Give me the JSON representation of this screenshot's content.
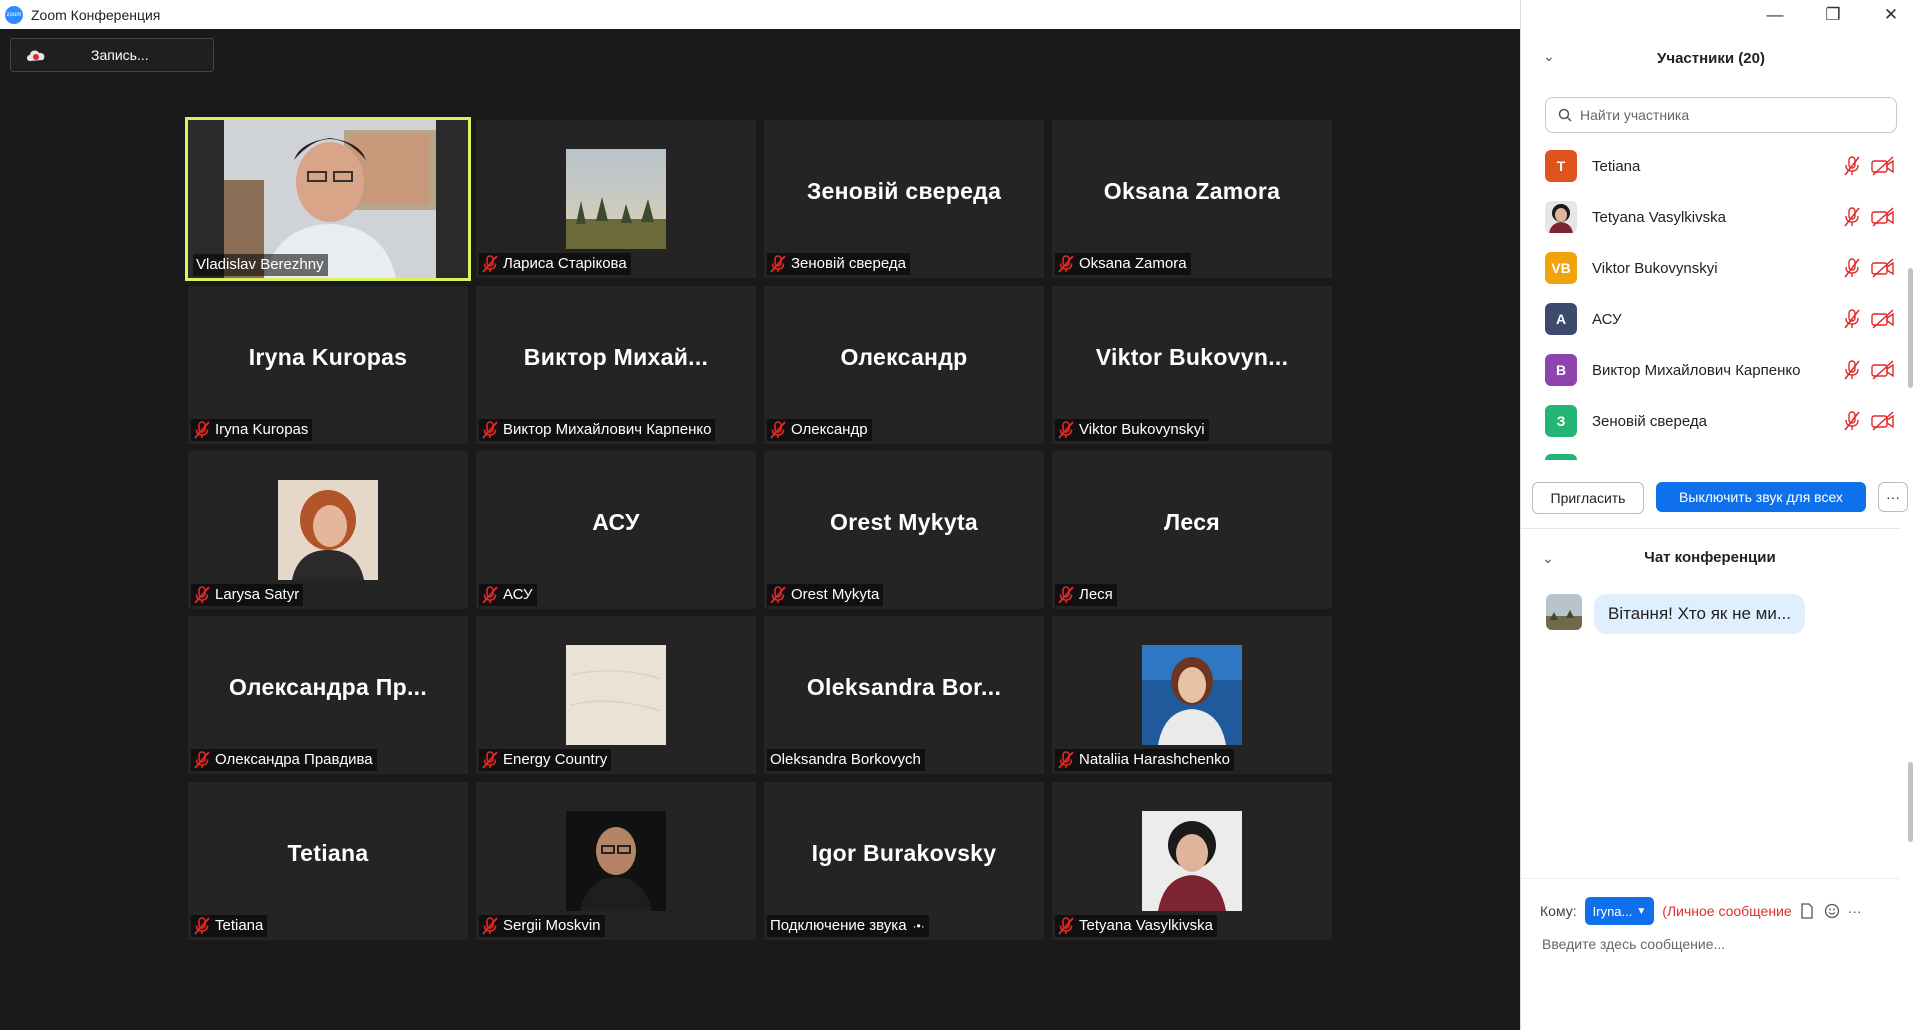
{
  "window": {
    "title": "Zoom Конференция",
    "controls": [
      "—",
      "❐",
      "✕"
    ]
  },
  "record": {
    "label": "Запись..."
  },
  "tiles": [
    {
      "id": "t1",
      "bigname": "",
      "nametag": "Vladislav Berezhny",
      "muted": false,
      "kind": "video"
    },
    {
      "id": "t2",
      "bigname": "",
      "nametag": "Лариса Старікова",
      "muted": true,
      "kind": "pic",
      "pic": "landscape"
    },
    {
      "id": "t3",
      "bigname": "Зеновій свереда",
      "nametag": "Зеновій свереда",
      "muted": true,
      "kind": "name"
    },
    {
      "id": "t4",
      "bigname": "Oksana Zamora",
      "nametag": "Oksana Zamora",
      "muted": true,
      "kind": "name"
    },
    {
      "id": "t5",
      "bigname": "Iryna Kuropas",
      "nametag": "Iryna Kuropas",
      "muted": true,
      "kind": "name"
    },
    {
      "id": "t6",
      "bigname": "Виктор Михай...",
      "nametag": "Виктор Михайлович Карпенко",
      "muted": true,
      "kind": "name"
    },
    {
      "id": "t7",
      "bigname": "Олександр",
      "nametag": "Олександр",
      "muted": true,
      "kind": "name"
    },
    {
      "id": "t8",
      "bigname": "Viktor Bukovyn...",
      "nametag": "Viktor Bukovynskyi",
      "muted": true,
      "kind": "name"
    },
    {
      "id": "t9",
      "bigname": "",
      "nametag": "Larysa Satyr",
      "muted": true,
      "kind": "pic",
      "pic": "woman-red"
    },
    {
      "id": "t10",
      "bigname": "АСУ",
      "nametag": "АСУ",
      "muted": true,
      "kind": "name"
    },
    {
      "id": "t11",
      "bigname": "Orest Mykyta",
      "nametag": "Orest Mykyta",
      "muted": true,
      "kind": "name"
    },
    {
      "id": "t12",
      "bigname": "Леся",
      "nametag": "Леся",
      "muted": true,
      "kind": "name"
    },
    {
      "id": "t13",
      "bigname": "Олександра Пр...",
      "nametag": "Олександра Правдива",
      "muted": true,
      "kind": "name"
    },
    {
      "id": "t14",
      "bigname": "",
      "nametag": "Energy Country",
      "muted": true,
      "kind": "pic",
      "pic": "paper"
    },
    {
      "id": "t15",
      "bigname": "Oleksandra Bor...",
      "nametag": "Oleksandra Borkovych",
      "muted": false,
      "kind": "name"
    },
    {
      "id": "t16",
      "bigname": "",
      "nametag": "Nataliia Harashchenko",
      "muted": true,
      "kind": "pic",
      "pic": "woman-blue"
    },
    {
      "id": "t17",
      "bigname": "Tetiana",
      "nametag": "Tetiana",
      "muted": true,
      "kind": "name"
    },
    {
      "id": "t18",
      "bigname": "",
      "nametag": "Sergii Moskvin",
      "muted": true,
      "kind": "pic",
      "pic": "man-glasses"
    },
    {
      "id": "t19",
      "bigname": "Igor Burakovsky",
      "nametag": "Подключение звука",
      "muted": false,
      "kind": "name",
      "connecting": true
    },
    {
      "id": "t20",
      "bigname": "",
      "nametag": "Tetyana Vasylkivska",
      "muted": true,
      "kind": "pic",
      "pic": "woman-dark"
    }
  ],
  "panel": {
    "participants_title": "Участники (20)",
    "search_placeholder": "Найти участника",
    "participants": [
      {
        "initials": "T",
        "name": "Tetiana",
        "color": "#e0531e"
      },
      {
        "initials": "",
        "name": "Tetyana Vasylkivska",
        "color": "#cfcfcf",
        "photo": true
      },
      {
        "initials": "VB",
        "name": "Viktor Bukovynskyi",
        "color": "#f0a30a"
      },
      {
        "initials": "A",
        "name": "АСУ",
        "color": "#3c4a6b"
      },
      {
        "initials": "В",
        "name": "Виктор Михайлович Карпенко",
        "color": "#8e44ad"
      },
      {
        "initials": "З",
        "name": "Зеновій свереда",
        "color": "#22b573"
      }
    ],
    "invite_label": "Пригласить",
    "mute_all_label": "Выключить звук для всех",
    "more_label": "···",
    "chat_title": "Чат конференции",
    "chat_message": "Вітання! Хто як не ми...",
    "to_label": "Кому:",
    "to_value": "Iryna...",
    "private_label": "(Личное сообщение",
    "compose_placeholder": "Введите здесь сообщение..."
  }
}
